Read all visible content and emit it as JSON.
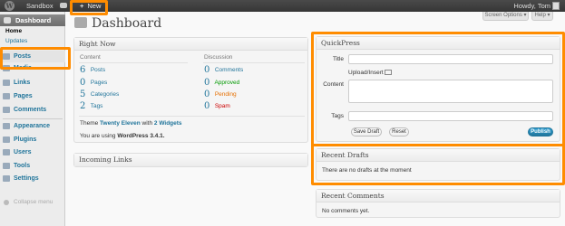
{
  "admin_bar": {
    "logo": "W",
    "site_name": "Sandbox",
    "new_label": "New",
    "howdy": "Howdy, Tom"
  },
  "sidebar": {
    "dashboard": "Dashboard",
    "sub": {
      "home": "Home",
      "updates": "Updates"
    },
    "items": [
      {
        "key": "posts",
        "label": "Posts"
      },
      {
        "key": "media",
        "label": "Media"
      },
      {
        "key": "links",
        "label": "Links"
      },
      {
        "key": "pages",
        "label": "Pages"
      },
      {
        "key": "comments",
        "label": "Comments"
      },
      {
        "key": "appearance",
        "label": "Appearance"
      },
      {
        "key": "plugins",
        "label": "Plugins"
      },
      {
        "key": "users",
        "label": "Users"
      },
      {
        "key": "tools",
        "label": "Tools"
      },
      {
        "key": "settings",
        "label": "Settings"
      }
    ],
    "collapse": "Collapse menu"
  },
  "top_tabs": {
    "screen_options": "Screen Options",
    "help": "Help"
  },
  "page_title": "Dashboard",
  "right_now": {
    "title": "Right Now",
    "content_header": "Content",
    "discussion_header": "Discussion",
    "content_rows": [
      {
        "count": "6",
        "label": "Posts"
      },
      {
        "count": "0",
        "label": "Pages"
      },
      {
        "count": "5",
        "label": "Categories"
      },
      {
        "count": "2",
        "label": "Tags"
      }
    ],
    "discussion_rows": [
      {
        "count": "0",
        "label": "Comments"
      },
      {
        "count": "0",
        "label": "Approved"
      },
      {
        "count": "0",
        "label": "Pending"
      },
      {
        "count": "0",
        "label": "Spam"
      }
    ],
    "theme_prefix": "Theme",
    "theme_name": "Twenty Eleven",
    "theme_with": "with",
    "widgets_link": "2 Widgets",
    "version_prefix": "You are using",
    "version": "WordPress 3.4.1."
  },
  "incoming_links": {
    "title": "Incoming Links"
  },
  "quickpress": {
    "title": "QuickPress",
    "title_label": "Title",
    "upload_label": "Upload/Insert",
    "content_label": "Content",
    "tags_label": "Tags",
    "save_draft": "Save Draft",
    "reset": "Reset",
    "publish": "Publish"
  },
  "recent_drafts": {
    "title": "Recent Drafts",
    "empty": "There are no drafts at the moment"
  },
  "recent_comments": {
    "title": "Recent Comments",
    "empty": "No comments yet."
  },
  "colors": {
    "highlight": "#ff8c00",
    "link": "#21759b"
  }
}
